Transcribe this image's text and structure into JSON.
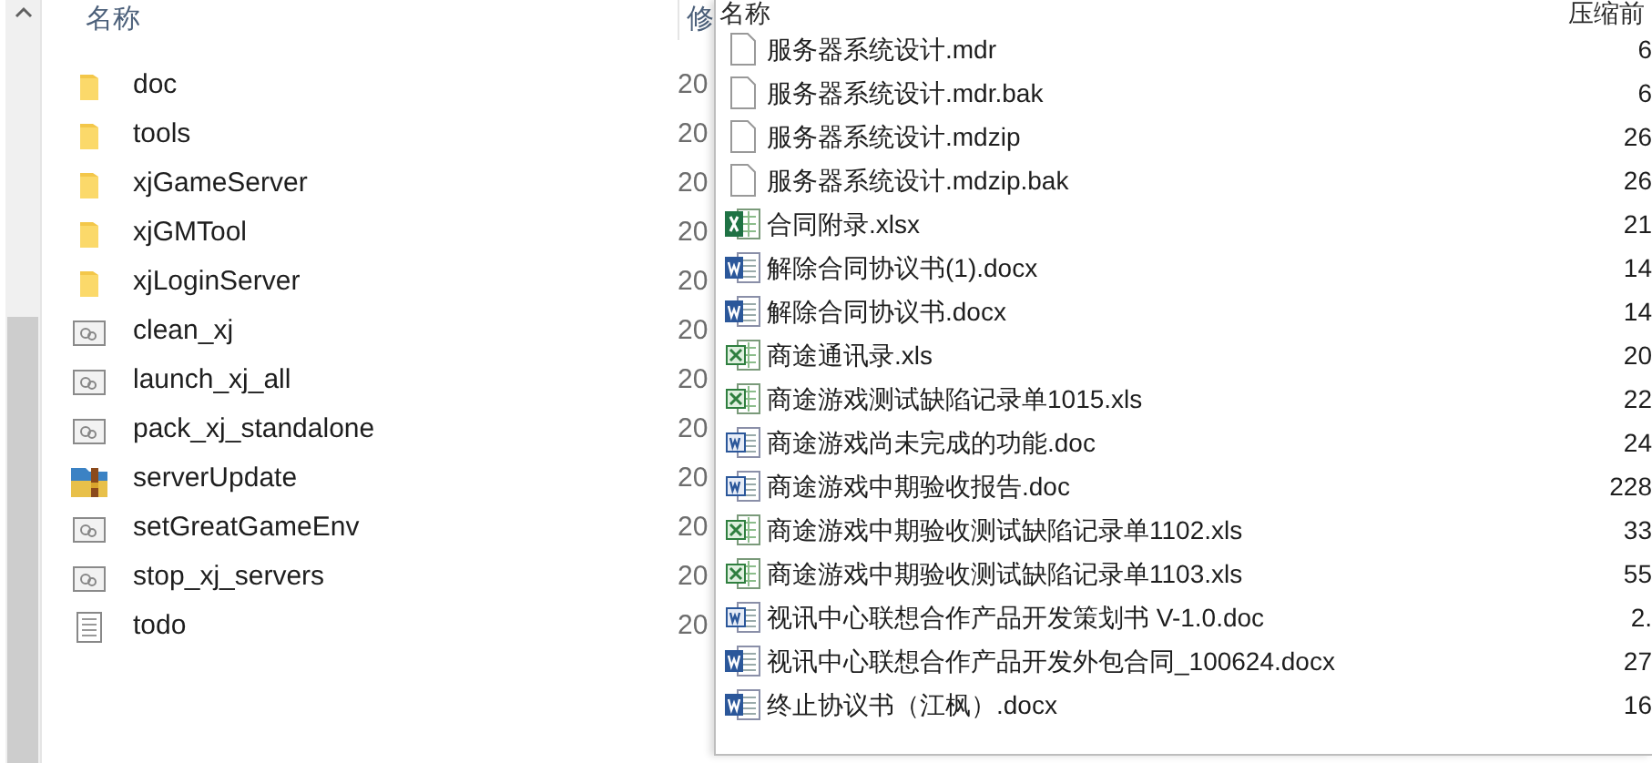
{
  "left_pane": {
    "columns": [
      "名称",
      "修"
    ],
    "rows": [
      {
        "kind": "folder",
        "name": "doc",
        "date": "20"
      },
      {
        "kind": "folder",
        "name": "tools",
        "date": "20"
      },
      {
        "kind": "folder",
        "name": "xjGameServer",
        "date": "20"
      },
      {
        "kind": "folder",
        "name": "xjGMTool",
        "date": "20"
      },
      {
        "kind": "folder",
        "name": "xjLoginServer",
        "date": "20"
      },
      {
        "kind": "script",
        "name": "clean_xj",
        "date": "20"
      },
      {
        "kind": "script",
        "name": "launch_xj_all",
        "date": "20"
      },
      {
        "kind": "script",
        "name": "pack_xj_standalone",
        "date": "20"
      },
      {
        "kind": "archive",
        "name": "serverUpdate",
        "date": "20"
      },
      {
        "kind": "script",
        "name": "setGreatGameEnv",
        "date": "20"
      },
      {
        "kind": "script",
        "name": "stop_xj_servers",
        "date": "20"
      },
      {
        "kind": "text",
        "name": "todo",
        "date": "20"
      }
    ]
  },
  "archive_pane": {
    "columns": [
      "名称",
      "压缩前"
    ],
    "rows": [
      {
        "kind": "blank",
        "name": "服务器系统设计.mdr",
        "size": "6"
      },
      {
        "kind": "blank",
        "name": "服务器系统设计.mdr.bak",
        "size": "6"
      },
      {
        "kind": "blank",
        "name": "服务器系统设计.mdzip",
        "size": "26"
      },
      {
        "kind": "blank",
        "name": "服务器系统设计.mdzip.bak",
        "size": "26"
      },
      {
        "kind": "xlsx",
        "name": "合同附录.xlsx",
        "size": "21"
      },
      {
        "kind": "docx",
        "name": "解除合同协议书(1).docx",
        "size": "14"
      },
      {
        "kind": "docx",
        "name": "解除合同协议书.docx",
        "size": "14"
      },
      {
        "kind": "xls",
        "name": "商途通讯录.xls",
        "size": "20"
      },
      {
        "kind": "xls",
        "name": "商途游戏测试缺陷记录单1015.xls",
        "size": "22"
      },
      {
        "kind": "doc",
        "name": "商途游戏尚未完成的功能.doc",
        "size": "24"
      },
      {
        "kind": "doc",
        "name": "商途游戏中期验收报告.doc",
        "size": "228"
      },
      {
        "kind": "xls",
        "name": "商途游戏中期验收测试缺陷记录单1102.xls",
        "size": "33"
      },
      {
        "kind": "xls",
        "name": "商途游戏中期验收测试缺陷记录单1103.xls",
        "size": "55"
      },
      {
        "kind": "doc",
        "name": "视讯中心联想合作产品开发策划书 V-1.0.doc",
        "size": "2."
      },
      {
        "kind": "docx",
        "name": "视讯中心联想合作产品开发外包合同_100624.docx",
        "size": "27"
      },
      {
        "kind": "docx",
        "name": "终止协议书（江枫）.docx",
        "size": "16"
      }
    ]
  }
}
